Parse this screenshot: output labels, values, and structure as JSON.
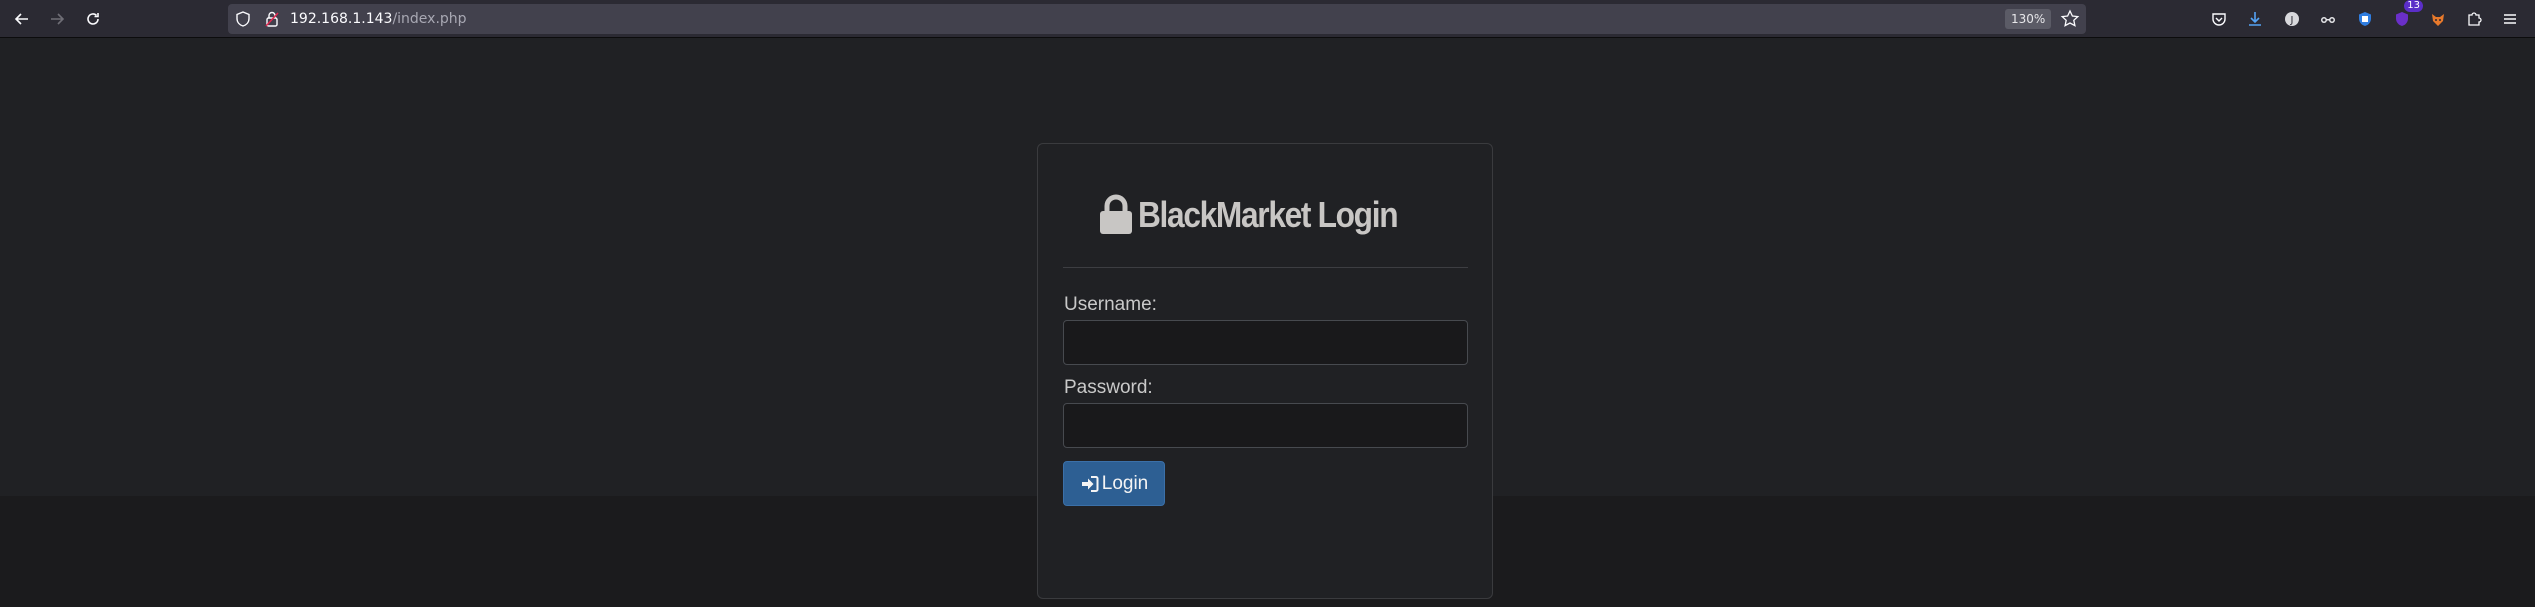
{
  "browser": {
    "url_host": "192.168.1.143",
    "url_path": "/index.php",
    "zoom": "130%",
    "extension_badge": "13",
    "icons": [
      "back-icon",
      "forward-icon",
      "reload-icon",
      "shield-icon",
      "lock-icon",
      "star-icon",
      "pocket-icon",
      "download-icon",
      "account-icon",
      "glasses-icon",
      "extension-shield-icon",
      "ublock-icon",
      "foxy-icon",
      "puzzle-icon",
      "menu-icon"
    ]
  },
  "login": {
    "title": "BlackMarket Login",
    "username_label": "Username:",
    "username_value": "",
    "password_label": "Password:",
    "password_value": "",
    "button_label": "Login"
  },
  "colors": {
    "page_bg": "#202124",
    "button_bg": "#2d5f93",
    "title_color": "#c8c6c4"
  }
}
